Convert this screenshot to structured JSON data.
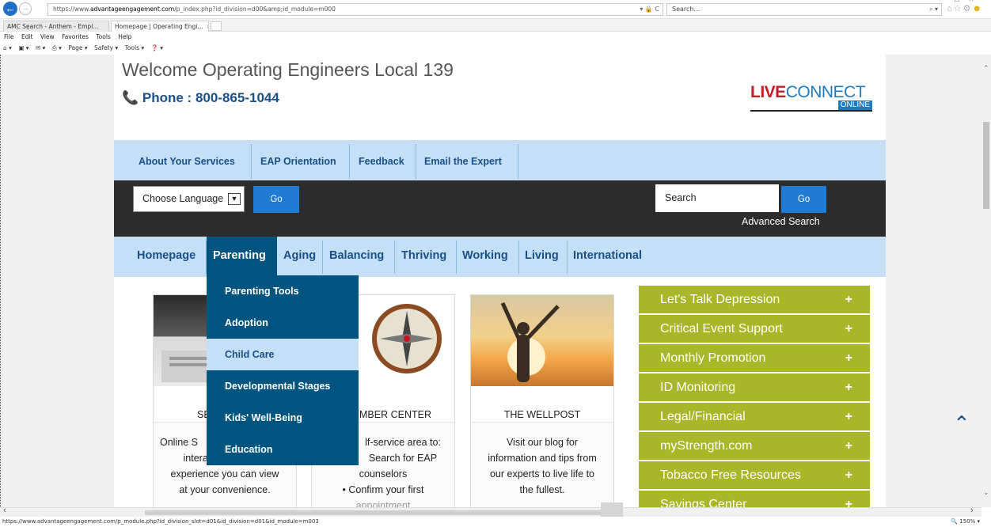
{
  "browser": {
    "url_prefix": "https://www.",
    "url_host": "advantageengagement.com",
    "url_path": "/p_index.php?id_division=d00&amp;id_module=m000",
    "url_tools": "▾ 🔒 C",
    "search_placeholder": "Search...",
    "search_icon": "⌕ ▾",
    "tabs": [
      {
        "label": "AMC Search - Anthem - Empl..."
      },
      {
        "label": "Homepage | Operating Engi...",
        "close": "×"
      }
    ],
    "menu": [
      "File",
      "Edit",
      "View",
      "Favorites",
      "Tools",
      "Help"
    ],
    "command_bar": [
      "⌂ ▾",
      "▣ ▾",
      "✉ ▾",
      "⎙ ▾",
      "Page ▾",
      "Safety ▾",
      "Tools ▾",
      "❓ ▾"
    ],
    "status_url": "https://www.advantageengagement.com/p_module.php?id_division_slot=d01&id_division=d01&id_module=m003",
    "zoom": "🔍 150%  ▾"
  },
  "header": {
    "welcome": "Welcome Operating Engineers Local 139",
    "phone": "📞 Phone : 800-865-1044",
    "logo_live": "LIVE",
    "logo_connect": "CONNECT",
    "logo_online": "ONLINE"
  },
  "topnav": [
    "About Your Services",
    "EAP Orientation",
    "Feedback",
    "Email the Expert"
  ],
  "language": {
    "select_value": "Choose Language",
    "go": "Go",
    "search_value": "Search",
    "search_go": "Go",
    "advanced_search": "Advanced Search"
  },
  "mainnav": [
    "Homepage",
    "Parenting",
    "Aging",
    "Balancing",
    "Thriving",
    "Working",
    "Living",
    "International"
  ],
  "dropdown": [
    "Parenting Tools",
    "Adoption",
    "Child Care",
    "Developmental Stages",
    "Kids' Well-Being",
    "Education"
  ],
  "cards": [
    {
      "title": "SE",
      "lines": [
        "Online S",
        "interactive learning",
        "experience you can view",
        "at your convenience."
      ]
    },
    {
      "title": "MBER CENTER",
      "lines": [
        "lf-service area to:",
        "Search for EAP",
        "counselors",
        "• Confirm your first",
        "appointment"
      ]
    },
    {
      "title": "THE WELLPOST",
      "lines": [
        "Visit our blog for",
        "information and tips from",
        "our experts to live life to",
        "the fullest."
      ]
    }
  ],
  "sidebar": [
    "Let's Talk Depression",
    "Critical Event Support",
    "Monthly Promotion",
    "ID Monitoring",
    "Legal/Financial",
    "myStrength.com",
    "Tobacco Free Resources",
    "Savings Center"
  ],
  "colors": {
    "nav_bg": "#c5dff6",
    "nav_text": "#1a4f87",
    "active_bg": "#005480",
    "dark_bar": "#2c2c2c",
    "go_button": "#1f7bd3",
    "sidebar_bg": "#a8b728"
  }
}
